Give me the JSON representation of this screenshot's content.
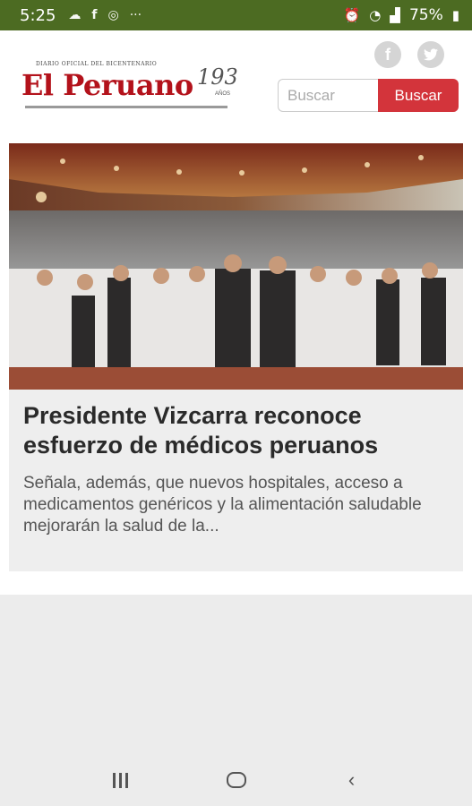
{
  "status_bar": {
    "time": "5:25",
    "notification_icons": [
      "cloud-upload-icon",
      "facebook-icon",
      "data-saver-icon",
      "more-dots-icon"
    ],
    "system_icons": [
      "alarm-icon",
      "wifi-icon",
      "signal-icon"
    ],
    "battery": "75%",
    "bg_color": "#4c6b22"
  },
  "header": {
    "logo": {
      "name": "El Peruano",
      "tagline": "DIARIO OFICIAL DEL BICENTENARIO",
      "years": "193",
      "years_label": "AÑOS",
      "brand_color": "#b3121b"
    },
    "social": [
      "facebook-icon",
      "twitter-icon"
    ],
    "search": {
      "placeholder": "Buscar",
      "button_label": "Buscar",
      "button_color": "#d3343b"
    }
  },
  "article": {
    "headline": "Presidente Vizcarra reconoce esfuerzo de médicos peruanos",
    "summary": "Señala, además, que nuevos hospitales, acceso a medicamentos genéricos y la alimentación saludable mejorarán la salud de la..."
  },
  "nav_bar": {
    "buttons": [
      "recent-apps-icon",
      "home-icon",
      "back-icon"
    ]
  }
}
